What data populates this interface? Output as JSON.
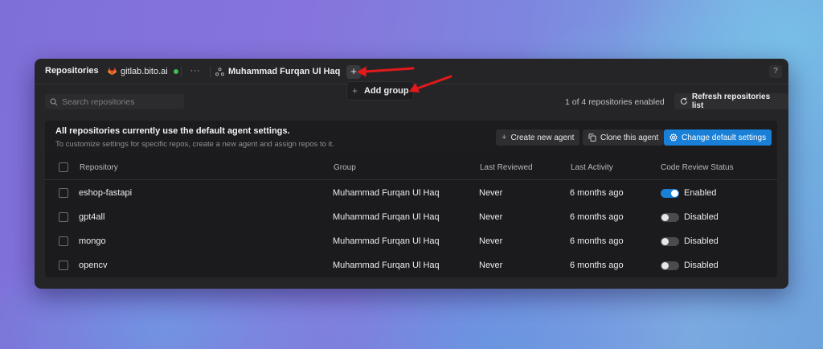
{
  "header": {
    "title": "Repositories",
    "source": "gitlab.bito.ai",
    "more": "···",
    "group": "Muhammad Furqan Ul Haq",
    "add": "+",
    "help": "?"
  },
  "dropdown": {
    "plus": "+",
    "label": "Add group"
  },
  "toolbar": {
    "search_placeholder": "Search repositories",
    "enabled_count": "1 of 4 repositories enabled",
    "refresh_label": "Refresh repositories list"
  },
  "banner": {
    "title": "All repositories currently use the default agent settings.",
    "subtitle": "To customize settings for specific repos, create a new agent and assign repos to it.",
    "create_label": "Create new agent",
    "clone_label": "Clone this agent",
    "change_label": "Change default settings"
  },
  "table": {
    "columns": [
      "Repository",
      "Group",
      "Last Reviewed",
      "Last Activity",
      "Code Review Status"
    ],
    "rows": [
      {
        "repo": "eshop-fastapi",
        "group": "Muhammad Furqan Ul Haq",
        "last_reviewed": "Never",
        "last_activity": "6 months ago",
        "status": "Enabled",
        "enabled": true
      },
      {
        "repo": "gpt4all",
        "group": "Muhammad Furqan Ul Haq",
        "last_reviewed": "Never",
        "last_activity": "6 months ago",
        "status": "Disabled",
        "enabled": false
      },
      {
        "repo": "mongo",
        "group": "Muhammad Furqan Ul Haq",
        "last_reviewed": "Never",
        "last_activity": "6 months ago",
        "status": "Disabled",
        "enabled": false
      },
      {
        "repo": "opencv",
        "group": "Muhammad Furqan Ul Haq",
        "last_reviewed": "Never",
        "last_activity": "6 months ago",
        "status": "Disabled",
        "enabled": false
      }
    ]
  },
  "colors": {
    "accent": "#1a7fd6",
    "annotation_arrow": "#e3191b",
    "online_dot": "#3fbf4f"
  }
}
